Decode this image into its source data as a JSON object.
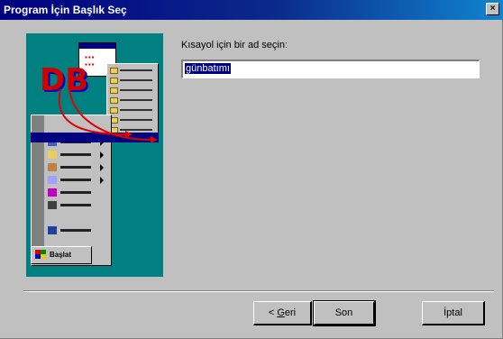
{
  "window": {
    "title": "Program İçin Başlık Seç",
    "close_glyph": "×"
  },
  "illustration": {
    "start_label": "Başlat"
  },
  "form": {
    "prompt": "Kısayol için bir ad seçin:",
    "name_value": "günbatımı"
  },
  "buttons": {
    "back_prefix": "< ",
    "back_accel": "G",
    "back_rest": "eri",
    "finish": "Son",
    "cancel": "İptal"
  }
}
